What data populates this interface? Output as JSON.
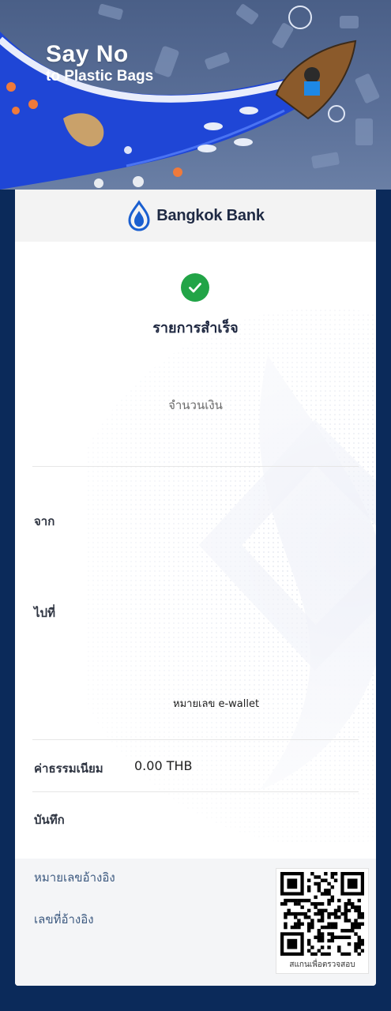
{
  "banner": {
    "title": "Say No",
    "subtitle": "to Plastic Bags"
  },
  "header": {
    "brand": "Bangkok Bank",
    "logo_icon": "lotus-drop-icon"
  },
  "status": {
    "icon": "check-circle-icon",
    "title": "รายการสำเร็จ",
    "color": "#22a447"
  },
  "amount": {
    "label": "จำนวนเงิน"
  },
  "details": {
    "from_label": "จาก",
    "to_label": "ไปที่",
    "wallet_label": "หมายเลข e-wallet",
    "fee_label": "ค่าธรรมเนียม",
    "fee_value": "0.00 THB",
    "memo_label": "บันทึก"
  },
  "footer": {
    "ref_no_label": "หมายเลขอ้างอิง",
    "ref_label": "เลขที่อ้างอิง",
    "qr_caption": "สแกนเพื่อตรวจสอบ"
  },
  "colors": {
    "page_bg": "#0b2a5a",
    "brand_blue": "#1a5fd0",
    "text_dark": "#1e2740",
    "ref_text": "#3d5a80"
  }
}
